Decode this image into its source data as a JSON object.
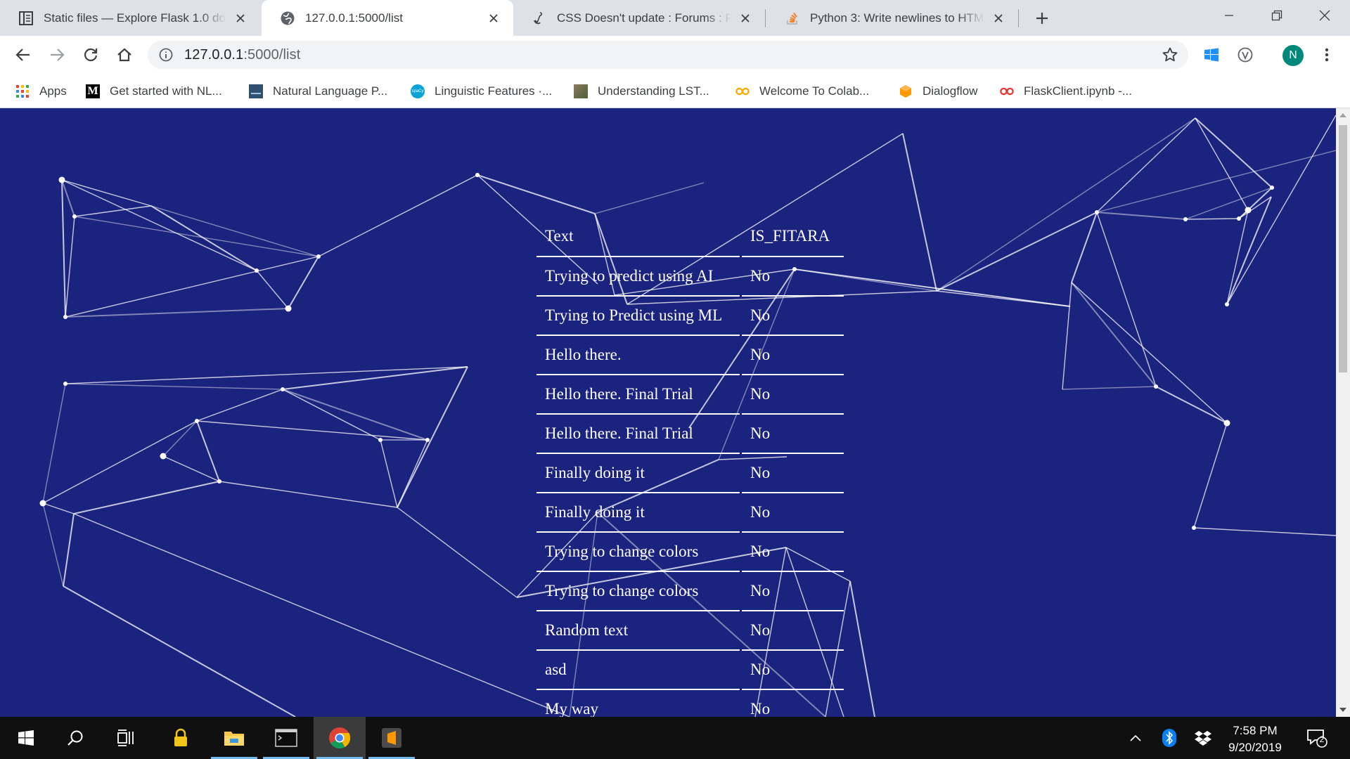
{
  "browser": {
    "tabs": [
      {
        "title": "Static files — Explore Flask 1.0 do",
        "icon": "book-icon",
        "active": false
      },
      {
        "title": "127.0.0.1:5000/list",
        "icon": "globe-icon",
        "active": true
      },
      {
        "title": "CSS Doesn't update : Forums : Py",
        "icon": "anchor-icon",
        "active": false
      },
      {
        "title": "Python 3: Write newlines to HTM",
        "icon": "stackoverflow-icon",
        "active": false
      }
    ],
    "address": {
      "host": "127.0.0.1",
      "path": ":5000/list"
    },
    "profile_initial": "N"
  },
  "bookmarks": [
    {
      "label": "Apps",
      "icon": "apps-grid-icon"
    },
    {
      "label": "Get started with NL...",
      "icon": "medium-icon"
    },
    {
      "label": "Natural Language P...",
      "icon": "document-thumb-icon"
    },
    {
      "label": "Linguistic Features ·...",
      "icon": "spacy-icon"
    },
    {
      "label": "Understanding LST...",
      "icon": "image-thumb-icon"
    },
    {
      "label": "Welcome To Colab...",
      "icon": "colab-icon"
    },
    {
      "label": "Dialogflow",
      "icon": "dialogflow-icon"
    },
    {
      "label": "FlaskClient.ipynb -...",
      "icon": "colab-icon"
    }
  ],
  "table": {
    "headers": [
      "Text",
      "IS_FITARA"
    ],
    "rows": [
      [
        "Trying to predict using AI",
        "No"
      ],
      [
        "Trying to Predict using ML",
        "No"
      ],
      [
        "Hello there.",
        "No"
      ],
      [
        "Hello there. Final Trial",
        "No"
      ],
      [
        "Hello there. Final Trial",
        "No"
      ],
      [
        "Finally doing it",
        "No"
      ],
      [
        "Finally doing it",
        "No"
      ],
      [
        "Trying to change colors",
        "No"
      ],
      [
        "Trying to change colors",
        "No"
      ],
      [
        "Random text",
        "No"
      ],
      [
        "asd",
        "No"
      ],
      [
        "My way",
        "No"
      ]
    ]
  },
  "theme": {
    "page_background": "#1a237e",
    "text": "#ffffff",
    "chrome_tabstrip": "#dee1e6"
  },
  "taskbar": {
    "apps": [
      "start-icon",
      "search-icon",
      "task-view-icon",
      "lock-app-icon",
      "file-explorer-icon",
      "terminal-icon",
      "chrome-icon",
      "sublime-icon"
    ],
    "time": "7:58 PM",
    "date": "9/20/2019",
    "notification_count": "2"
  }
}
